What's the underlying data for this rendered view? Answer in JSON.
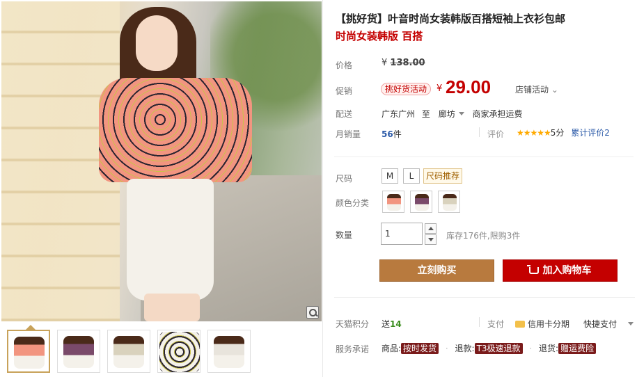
{
  "product": {
    "title": "【挑好货】叶音时尚女装韩版百搭短袖上衣衫包邮",
    "subtitle": "时尚女装韩版 百搭"
  },
  "price": {
    "label": "价格",
    "original_currency": "¥",
    "original": "138.00",
    "promo_label": "促销",
    "promo_tag": "挑好货活动",
    "current_currency": "¥",
    "current": "29.00",
    "shop_activity": "店铺活动"
  },
  "shipping": {
    "label": "配送",
    "from": "广东广州",
    "to_word": "至",
    "to": "廊坊",
    "fee": "商家承担运费"
  },
  "sales": {
    "label": "月销量",
    "count": "56",
    "unit": "件",
    "review_label": "评价",
    "stars": "★★★★★",
    "score": "5分",
    "review_link": "累计评价2"
  },
  "options": {
    "size_label": "尺码",
    "sizes": [
      "M",
      "L"
    ],
    "size_guide": "尺码推荐",
    "color_label": "颜色分类"
  },
  "quantity": {
    "label": "数量",
    "value": "1",
    "stock": "库存176件,限购3件"
  },
  "actions": {
    "buy_now": "立刻购买",
    "add_to_cart": "加入购物车"
  },
  "points": {
    "label": "天猫积分",
    "give": "送",
    "amount": "14",
    "pay_label": "支付",
    "credit": "信用卡分期",
    "quick_pay": "快捷支付"
  },
  "service": {
    "label": "服务承诺",
    "item1_prefix": "商品:",
    "item1_badge": "按时发货",
    "item2_prefix": "退款:",
    "item2_badge": "T3极速退款",
    "item3_prefix": "退货:",
    "item3_badge": "赠运费险"
  },
  "colors": {
    "price_red": "#c40000",
    "buy_brown": "#b87a3e",
    "link_blue": "#2b5aa8"
  }
}
